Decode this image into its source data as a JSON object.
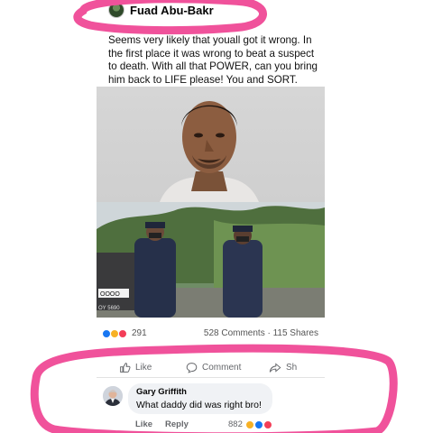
{
  "post": {
    "author": "Fuad Abu-Bakr",
    "text": "Seems very likely that youall got it wrong. In the first place it was wrong to beat a suspect to death. With all that POWER, can you bring him back to LIFE please! You and SORT.",
    "photo_bottom": {
      "vehicle_plate": "OY 5690"
    }
  },
  "stats": {
    "reactions_count": "291",
    "comments_shares": "528 Comments · 115 Shares"
  },
  "actions": {
    "like": "Like",
    "comment": "Comment",
    "share": "Sh"
  },
  "comment": {
    "name": "Gary Griffith",
    "text": "What daddy did was right bro!",
    "like": "Like",
    "reply": "Reply",
    "reaction_count": "882"
  },
  "colors": {
    "marker": "#f0529b",
    "facebook_blue": "#1877f2"
  }
}
